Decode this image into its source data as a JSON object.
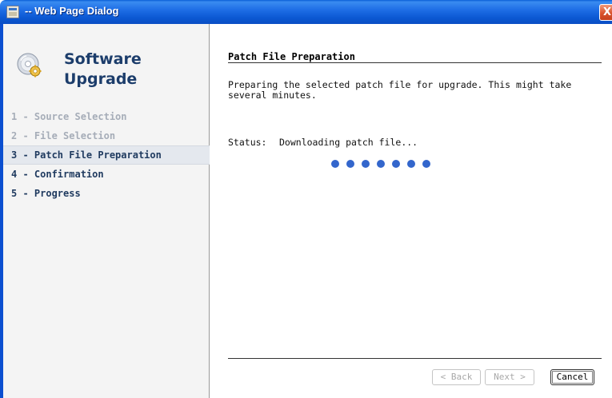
{
  "window": {
    "title": "-- Web Page Dialog",
    "close_glyph": "X"
  },
  "sidebar": {
    "heading_line1": "Software",
    "heading_line2": "Upgrade",
    "logo_icon": "cd-gear-icon",
    "steps": [
      {
        "label": "1 - Source Selection",
        "state": "done"
      },
      {
        "label": "2 - File Selection",
        "state": "done"
      },
      {
        "label": "3 - Patch File Preparation",
        "state": "active"
      },
      {
        "label": "4 - Confirmation",
        "state": "pending"
      },
      {
        "label": "5 - Progress",
        "state": "pending"
      }
    ]
  },
  "main": {
    "section_title": "Patch File Preparation",
    "description": "Preparing the selected patch file for upgrade. This might take several minutes.",
    "status_label": "Status:",
    "status_value": "Downloading patch file...",
    "progress_dot_count": 7,
    "progress_dot_color": "#3366cc"
  },
  "buttons": {
    "back_label": "< Back",
    "next_label": "Next >",
    "cancel_label": "Cancel"
  },
  "colors": {
    "titlebar": "#0b58d2",
    "heading": "#1c3d6b",
    "step_done": "#a6adb8",
    "step_pending": "#1f3a5f"
  }
}
